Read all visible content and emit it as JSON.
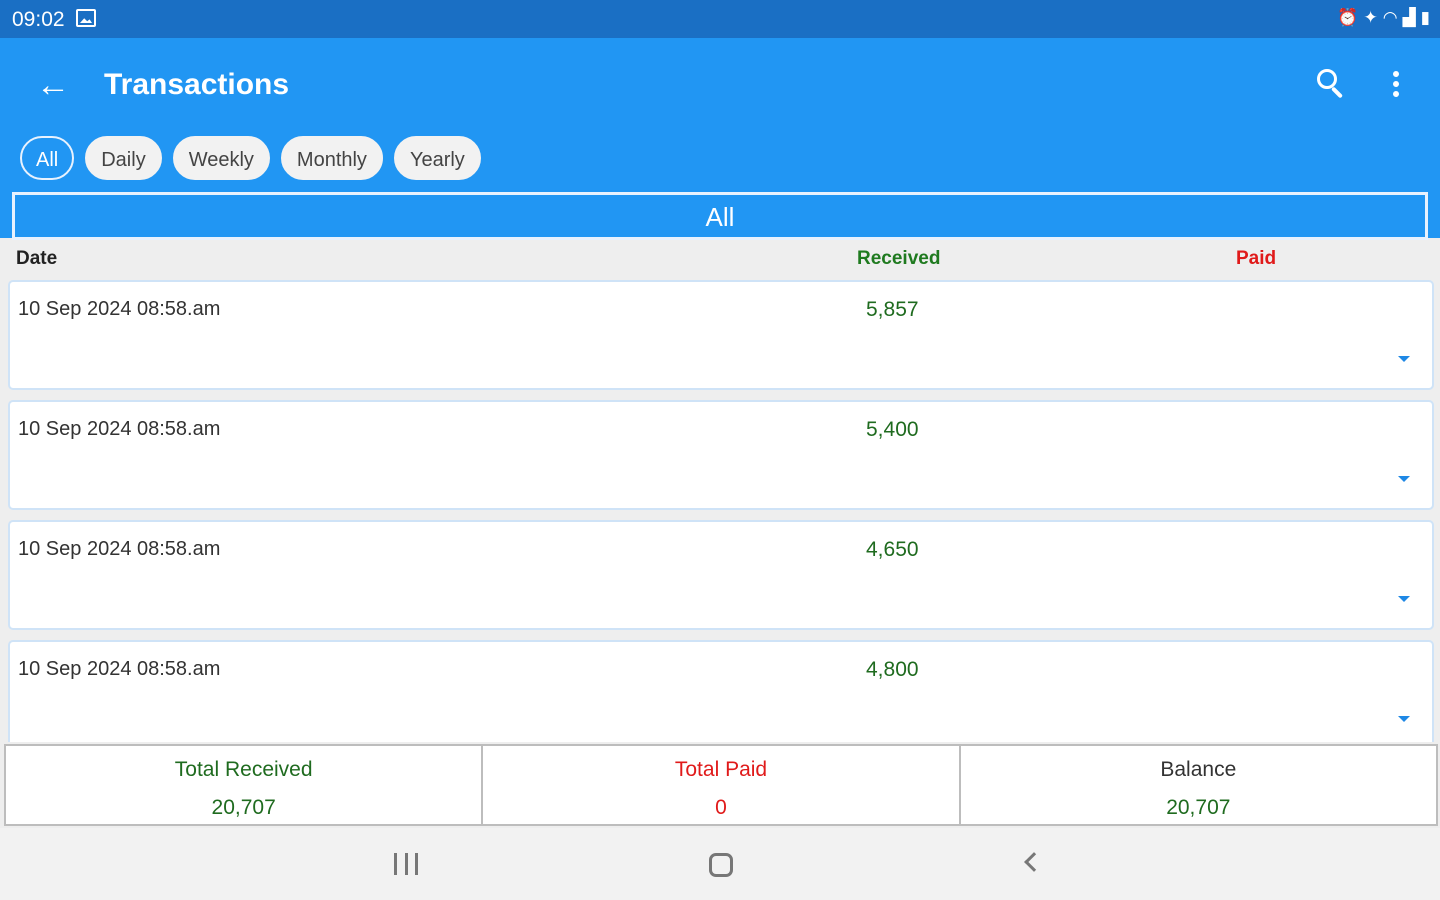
{
  "status_bar": {
    "time": "09:02",
    "icons": [
      "gallery-icon",
      "alarm-icon",
      "vibrate-icon",
      "wifi-icon",
      "signal-icon",
      "battery-icon"
    ]
  },
  "app_bar": {
    "title": "Transactions",
    "icons": [
      "back-arrow-icon",
      "search-icon",
      "more-vert-icon"
    ],
    "color": "#2196f3"
  },
  "filters": {
    "chips": [
      {
        "label": "All",
        "selected": true
      },
      {
        "label": "Daily",
        "selected": false
      },
      {
        "label": "Weekly",
        "selected": false
      },
      {
        "label": "Monthly",
        "selected": false
      },
      {
        "label": "Yearly",
        "selected": false
      }
    ]
  },
  "period": {
    "label": "All"
  },
  "columns": {
    "date": "Date",
    "received": "Received",
    "paid": "Paid"
  },
  "transactions": [
    {
      "date": "10 Sep 2024 08:58.am",
      "received": "5,857",
      "paid": ""
    },
    {
      "date": "10 Sep 2024 08:58.am",
      "received": "5,400",
      "paid": ""
    },
    {
      "date": "10 Sep 2024 08:58.am",
      "received": "4,650",
      "paid": ""
    },
    {
      "date": "10 Sep 2024 08:58.am",
      "received": "4,800",
      "paid": ""
    }
  ],
  "totals": {
    "received_label": "Total Received",
    "received_value": "20,707",
    "paid_label": "Total Paid",
    "paid_value": "0",
    "balance_label": "Balance",
    "balance_value": "20,707"
  },
  "colors": {
    "received": "#1f7a1f",
    "paid": "#e01a1a",
    "status_bar": "#1a6fc4"
  }
}
